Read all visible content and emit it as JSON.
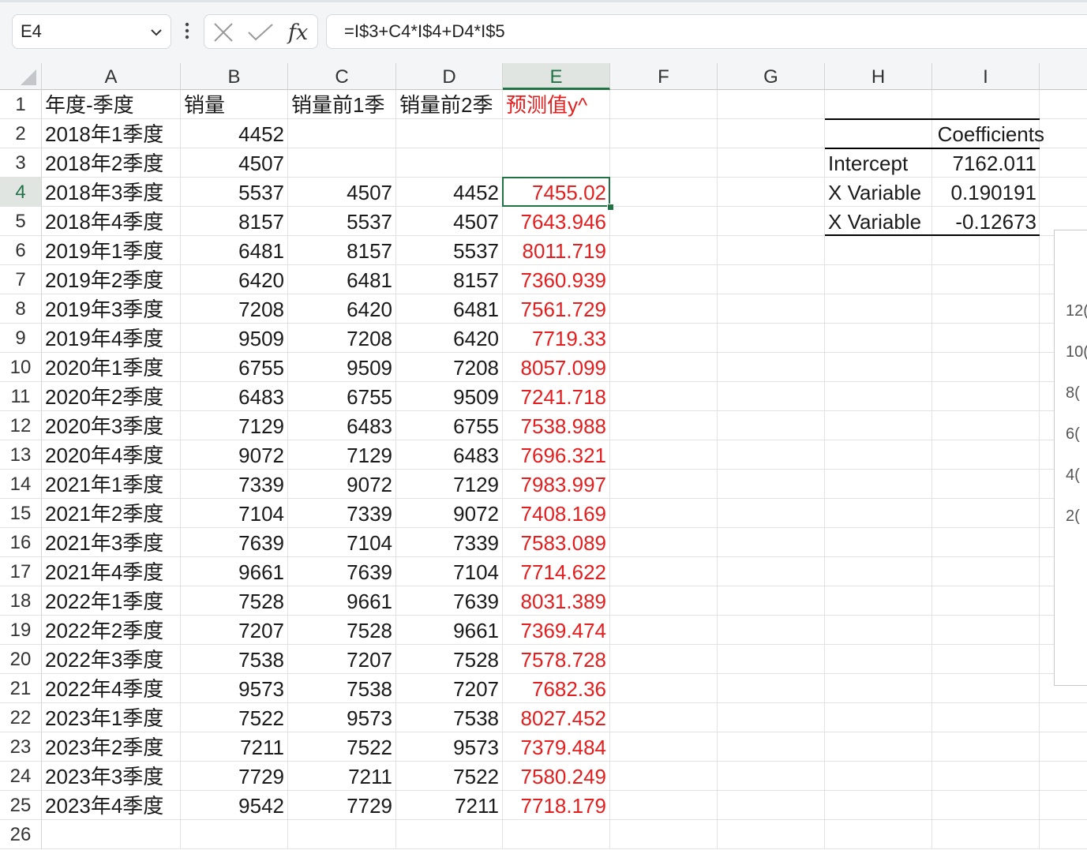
{
  "formula_bar": {
    "name_box": "E4",
    "formula": "=I$3+C4*I$4+D4*I$5"
  },
  "sheet": {
    "columns": [
      "A",
      "B",
      "C",
      "D",
      "E",
      "F",
      "G",
      "H",
      "I",
      ""
    ],
    "selected_column": "E",
    "selected_row": 4,
    "header_row": [
      "年度-季度",
      "销量",
      "销量前1季",
      "销量前2季",
      "预测值y^"
    ],
    "rows": [
      [
        "2018年1季度",
        "4452",
        "",
        "",
        ""
      ],
      [
        "2018年2季度",
        "4507",
        "",
        "",
        ""
      ],
      [
        "2018年3季度",
        "5537",
        "4507",
        "4452",
        "7455.02"
      ],
      [
        "2018年4季度",
        "8157",
        "5537",
        "4507",
        "7643.946"
      ],
      [
        "2019年1季度",
        "6481",
        "8157",
        "5537",
        "8011.719"
      ],
      [
        "2019年2季度",
        "6420",
        "6481",
        "8157",
        "7360.939"
      ],
      [
        "2019年3季度",
        "7208",
        "6420",
        "6481",
        "7561.729"
      ],
      [
        "2019年4季度",
        "9509",
        "7208",
        "6420",
        "7719.33"
      ],
      [
        "2020年1季度",
        "6755",
        "9509",
        "7208",
        "8057.099"
      ],
      [
        "2020年2季度",
        "6483",
        "6755",
        "9509",
        "7241.718"
      ],
      [
        "2020年3季度",
        "7129",
        "6483",
        "6755",
        "7538.988"
      ],
      [
        "2020年4季度",
        "9072",
        "7129",
        "6483",
        "7696.321"
      ],
      [
        "2021年1季度",
        "7339",
        "9072",
        "7129",
        "7983.997"
      ],
      [
        "2021年2季度",
        "7104",
        "7339",
        "9072",
        "7408.169"
      ],
      [
        "2021年3季度",
        "7639",
        "7104",
        "7339",
        "7583.089"
      ],
      [
        "2021年4季度",
        "9661",
        "7639",
        "7104",
        "7714.622"
      ],
      [
        "2022年1季度",
        "7528",
        "9661",
        "7639",
        "8031.389"
      ],
      [
        "2022年2季度",
        "7207",
        "7528",
        "9661",
        "7369.474"
      ],
      [
        "2022年3季度",
        "7538",
        "7207",
        "7528",
        "7578.728"
      ],
      [
        "2022年4季度",
        "9573",
        "7538",
        "7207",
        "7682.36"
      ],
      [
        "2023年1季度",
        "7522",
        "9573",
        "7538",
        "8027.452"
      ],
      [
        "2023年2季度",
        "7211",
        "7522",
        "9573",
        "7379.484"
      ],
      [
        "2023年3季度",
        "7729",
        "7211",
        "7522",
        "7580.249"
      ],
      [
        "2023年4季度",
        "9542",
        "7729",
        "7211",
        "7718.179"
      ]
    ],
    "coefficients": {
      "header": "Coefficients",
      "rows": [
        {
          "label": "Intercept",
          "value": "7162.011"
        },
        {
          "label": "X Variable",
          "value": "0.190191"
        },
        {
          "label": "X Variable",
          "value": "-0.12673"
        }
      ]
    },
    "chart_partial_ticks": [
      "12(",
      "10(",
      "8(",
      "6(",
      "4(",
      "2("
    ],
    "last_row_partial": "26"
  },
  "colors": {
    "accent": "#217346",
    "prediction_text": "#e41e1e"
  }
}
